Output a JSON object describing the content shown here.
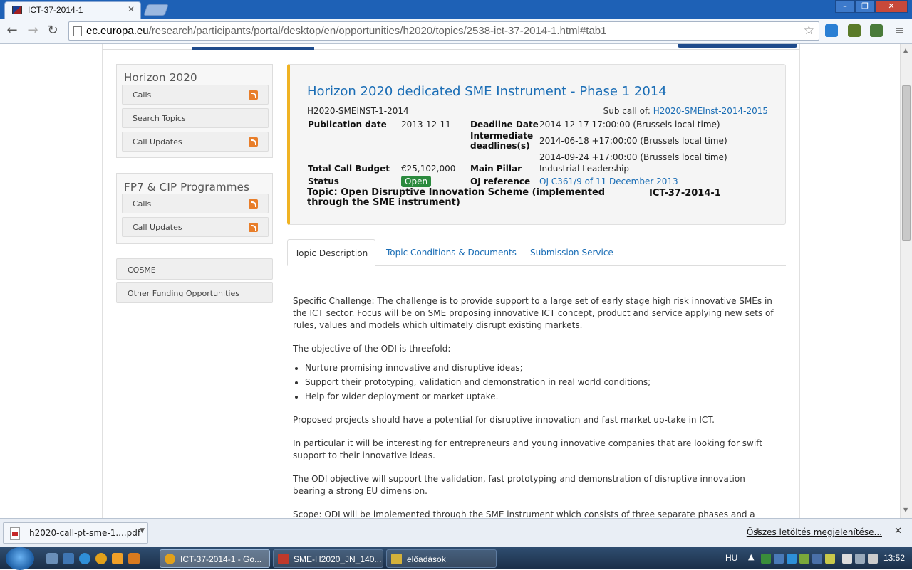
{
  "browser": {
    "tab_title": "ICT-37-2014-1",
    "tab_close": "✕",
    "win_min": "–",
    "win_max": "❐",
    "win_close": "✕",
    "url_host": "ec.europa.eu",
    "url_path": "/research/participants/portal/desktop/en/opportunities/h2020/topics/2538-ict-37-2014-1.html#tab1"
  },
  "sidebar": {
    "horizon": {
      "title": "Horizon 2020",
      "items": [
        {
          "label": "Calls",
          "rss": true
        },
        {
          "label": "Search Topics",
          "rss": false
        },
        {
          "label": "Call Updates",
          "rss": true
        }
      ]
    },
    "fp7": {
      "title": "FP7 & CIP Programmes",
      "items": [
        {
          "label": "Calls",
          "rss": true
        },
        {
          "label": "Call Updates",
          "rss": true
        }
      ]
    },
    "links": [
      {
        "label": "COSME"
      },
      {
        "label": "Other Funding Opportunities"
      }
    ]
  },
  "call": {
    "title": "Horizon 2020 dedicated SME Instrument - Phase 1 2014",
    "identifier": "H2020-SMEINST-1-2014",
    "subcall_label": "Sub call of:",
    "subcall_link": "H2020-SMEInst-2014-2015",
    "publication_label": "Publication date",
    "publication_date": "2013-12-11",
    "deadline_label": "Deadline Date",
    "deadline_date": "2014-12-17 17:00:00 (Brussels local time)",
    "intermediate_label_1": "Intermediate",
    "intermediate_label_2": "deadlines(s)",
    "intermediate_1": "2014-06-18 +17:00:00 (Brussels local time)",
    "intermediate_2": "2014-09-24 +17:00:00 (Brussels local time)",
    "budget_label": "Total Call Budget",
    "budget": "€25,102,000",
    "pillar_label": "Main Pillar",
    "pillar": "Industrial Leadership",
    "status_label": "Status",
    "status": "Open",
    "oj_label": "OJ reference",
    "oj_ref": "OJ C361/9 of 11 December 2013",
    "topic_label": "Topic:",
    "topic_text": "Open Disruptive Innovation Scheme (implemented through the SME instrument)",
    "topic_code": "ICT-37-2014-1"
  },
  "tabs": [
    {
      "label": "Topic Description",
      "active": true
    },
    {
      "label": "Topic Conditions & Documents",
      "active": false
    },
    {
      "label": "Submission Service",
      "active": false
    }
  ],
  "description": {
    "challenge_label": "Specific Challenge",
    "challenge_text": ": The challenge is to provide support to a large set of early stage high risk innovative SMEs in the ICT sector. Focus will be on SME proposing innovative ICT concept, product and service applying new sets of rules, values and models which ultimately disrupt existing markets.",
    "objective": "The objective of the ODI is threefold:",
    "bullets": [
      "Nurture promising innovative and disruptive ideas;",
      "Support their prototyping, validation and demonstration in real world conditions;",
      "Help for wider deployment or market uptake."
    ],
    "p1": "Proposed projects should have a potential for disruptive innovation and fast market up-take in ICT.",
    "p2": "In particular it will be interesting for entrepreneurs and young innovative companies that are looking for swift support to their innovative ideas.",
    "p3": "The ODI objective will support the validation, fast prototyping and demonstration of disruptive innovation bearing a strong EU dimension.",
    "p4": "Scope: ODI will be implemented through the SME instrument which consists of three separate phases and a coaching"
  },
  "downloads": {
    "file": "h2020-call-pt-sme-1....pdf",
    "show_all": "Összes letöltés megjelenítése...",
    "close": "✕"
  },
  "taskbar": {
    "tasks": [
      {
        "label": "ICT-37-2014-1 - Go...",
        "active": true,
        "color": "#e2a11a"
      },
      {
        "label": "SME-H2020_JN_140...",
        "active": false,
        "color": "#c0392b"
      },
      {
        "label": "előadások",
        "active": false,
        "color": "#d4b13a"
      }
    ],
    "lang": "HU",
    "time": "13:52"
  },
  "colors": {
    "accent_link": "#1a6db5",
    "status_open": "#2b8a3e",
    "call_border": "#f0b323",
    "rss": "#e87e2a"
  }
}
